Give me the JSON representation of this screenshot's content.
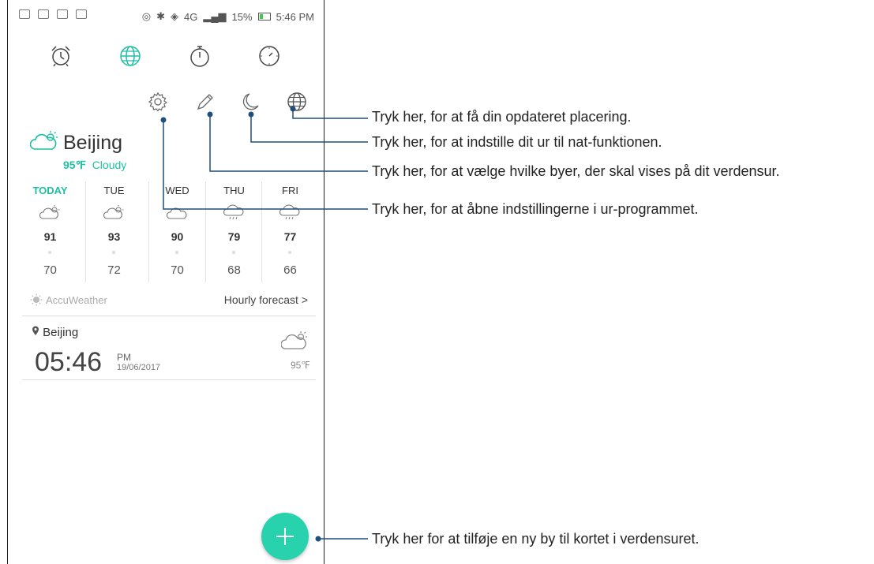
{
  "status_bar": {
    "network": "4G",
    "battery": "15%",
    "time": "5:46 PM"
  },
  "tabs": [
    "alarm-clock",
    "world-clock",
    "stopwatch",
    "timer"
  ],
  "active_tab": "world-clock",
  "toolbar": [
    "settings",
    "edit",
    "night-mode",
    "location"
  ],
  "weather": {
    "city": "Beijing",
    "temperature": "95℉",
    "condition": "Cloudy",
    "forecast": [
      {
        "day": "TODAY",
        "high": "91",
        "low": "70"
      },
      {
        "day": "TUE",
        "high": "93",
        "low": "72"
      },
      {
        "day": "WED",
        "high": "90",
        "low": "70"
      },
      {
        "day": "THU",
        "high": "79",
        "low": "68"
      },
      {
        "day": "FRI",
        "high": "77",
        "low": "66"
      }
    ],
    "provider": "AccuWeather",
    "hourly_link": "Hourly forecast >"
  },
  "world_clock": {
    "city": "Beijing",
    "time": "05:46",
    "ampm": "PM",
    "date": "19/06/2017",
    "temperature": "95℉"
  },
  "colors": {
    "accent": "#1fbfa3",
    "fab": "#27d2ad"
  },
  "callouts": {
    "location": "Tryk her, for at få din opdateret placering.",
    "night": "Tryk her, for at indstille dit ur til nat-funktionen.",
    "edit": "Tryk her, for at vælge hvilke byer, der skal vises på dit verdensur.",
    "settings": "Tryk her, for at åbne indstillingerne i ur-programmet.",
    "add": "Tryk her for at tilføje en ny by til kortet i verdensuret."
  }
}
